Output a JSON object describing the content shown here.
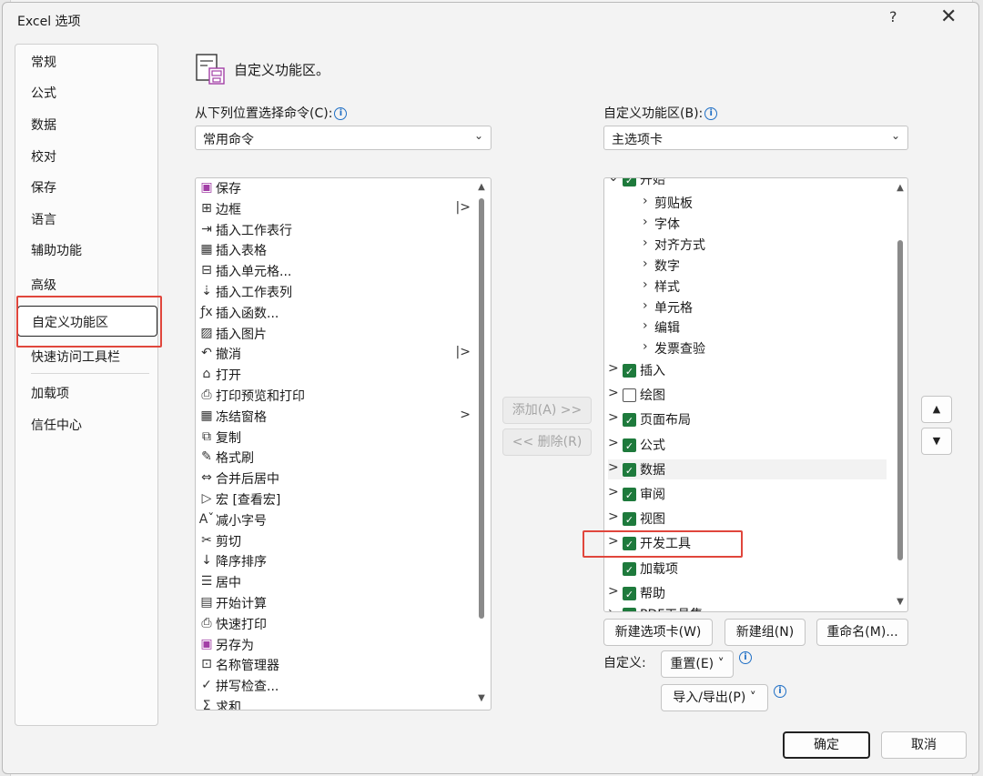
{
  "window": {
    "title": "Excel 选项",
    "help": "?",
    "close": "✕"
  },
  "nav": {
    "items": [
      "常规",
      "公式",
      "数据",
      "校对",
      "保存",
      "语言",
      "辅助功能",
      "高级",
      "自定义功能区",
      "快速访问工具栏",
      "加载项",
      "信任中心"
    ],
    "selected": "自定义功能区"
  },
  "header": {
    "title": "自定义功能区。"
  },
  "left_panel": {
    "label": "从下列位置选择命令(C):",
    "select_value": "常用命令",
    "commands": [
      {
        "label": "保存",
        "icon": "save-icon",
        "glyph": "▣",
        "arrow": ""
      },
      {
        "label": "边框",
        "icon": "border-icon",
        "glyph": "⊞",
        "arrow": "|>"
      },
      {
        "label": "插入工作表行",
        "icon": "insert-row-icon",
        "glyph": "⇥",
        "arrow": ""
      },
      {
        "label": "插入表格",
        "icon": "insert-table-icon",
        "glyph": "▦",
        "arrow": ""
      },
      {
        "label": "插入单元格...",
        "icon": "insert-cells-icon",
        "glyph": "⊟",
        "arrow": ""
      },
      {
        "label": "插入工作表列",
        "icon": "insert-column-icon",
        "glyph": "⇣",
        "arrow": ""
      },
      {
        "label": "插入函数...",
        "icon": "function-icon",
        "glyph": "ƒx",
        "arrow": ""
      },
      {
        "label": "插入图片",
        "icon": "picture-icon",
        "glyph": "▨",
        "arrow": ""
      },
      {
        "label": "撤消",
        "icon": "undo-icon",
        "glyph": "↶",
        "arrow": "|>"
      },
      {
        "label": "打开",
        "icon": "open-folder-icon",
        "glyph": "⌂",
        "arrow": ""
      },
      {
        "label": "打印预览和打印",
        "icon": "print-preview-icon",
        "glyph": "⎙",
        "arrow": ""
      },
      {
        "label": "冻结窗格",
        "icon": "freeze-panes-icon",
        "glyph": "▦",
        "arrow": ">"
      },
      {
        "label": "复制",
        "icon": "copy-icon",
        "glyph": "⧉",
        "arrow": ""
      },
      {
        "label": "格式刷",
        "icon": "format-painter-icon",
        "glyph": "✎",
        "arrow": ""
      },
      {
        "label": "合并后居中",
        "icon": "merge-center-icon",
        "glyph": "⇔",
        "arrow": ""
      },
      {
        "label": "宏 [查看宏]",
        "icon": "macro-icon",
        "glyph": "▷",
        "arrow": ""
      },
      {
        "label": "减小字号",
        "icon": "decrease-font-icon",
        "glyph": "Aˇ",
        "arrow": ""
      },
      {
        "label": "剪切",
        "icon": "cut-icon",
        "glyph": "✂",
        "arrow": ""
      },
      {
        "label": "降序排序",
        "icon": "sort-desc-icon",
        "glyph": "↓",
        "arrow": ""
      },
      {
        "label": "居中",
        "icon": "align-center-icon",
        "glyph": "☰",
        "arrow": ""
      },
      {
        "label": "开始计算",
        "icon": "calculator-icon",
        "glyph": "▤",
        "arrow": ""
      },
      {
        "label": "快速打印",
        "icon": "quick-print-icon",
        "glyph": "⎙",
        "arrow": ""
      },
      {
        "label": "另存为",
        "icon": "save-as-icon",
        "glyph": "▣",
        "arrow": ""
      },
      {
        "label": "名称管理器",
        "icon": "name-manager-icon",
        "glyph": "⊡",
        "arrow": ""
      },
      {
        "label": "拼写检查...",
        "icon": "spell-check-icon",
        "glyph": "✓",
        "arrow": ""
      },
      {
        "label": "求和",
        "icon": "sum-icon",
        "glyph": "Σ",
        "arrow": ""
      }
    ]
  },
  "middle": {
    "add": "添加(A) >>",
    "remove": "<< 删除(R)"
  },
  "right_panel": {
    "label": "自定义功能区(B):",
    "select_value": "主选项卡",
    "top_partial": "开始",
    "sub_groups": [
      "剪贴板",
      "字体",
      "对齐方式",
      "数字",
      "样式",
      "单元格",
      "编辑",
      "发票查验"
    ],
    "tabs": [
      {
        "label": "插入",
        "checked": true,
        "expander": ">"
      },
      {
        "label": "绘图",
        "checked": false,
        "expander": ">"
      },
      {
        "label": "页面布局",
        "checked": true,
        "expander": ">"
      },
      {
        "label": "公式",
        "checked": true,
        "expander": ">"
      },
      {
        "label": "数据",
        "checked": true,
        "expander": ">"
      },
      {
        "label": "审阅",
        "checked": true,
        "expander": ">"
      },
      {
        "label": "视图",
        "checked": true,
        "expander": ">"
      },
      {
        "label": "开发工具",
        "checked": true,
        "expander": ">"
      },
      {
        "label": "加载项",
        "checked": true,
        "expander": ""
      },
      {
        "label": "帮助",
        "checked": true,
        "expander": ">"
      }
    ],
    "bottom_partial": "PDF工具集",
    "buttons": {
      "new_tab": "新建选项卡(W)",
      "new_group": "新建组(N)",
      "rename": "重命名(M)..."
    },
    "customize_label": "自定义:",
    "reset": "重置(E) ˅",
    "import_export": "导入/导出(P) ˅"
  },
  "footer": {
    "ok": "确定",
    "cancel": "取消"
  },
  "colors": {
    "checkbox": "#1e7a3c",
    "highlight": "#e0463c",
    "info": "#1f6fc5"
  }
}
